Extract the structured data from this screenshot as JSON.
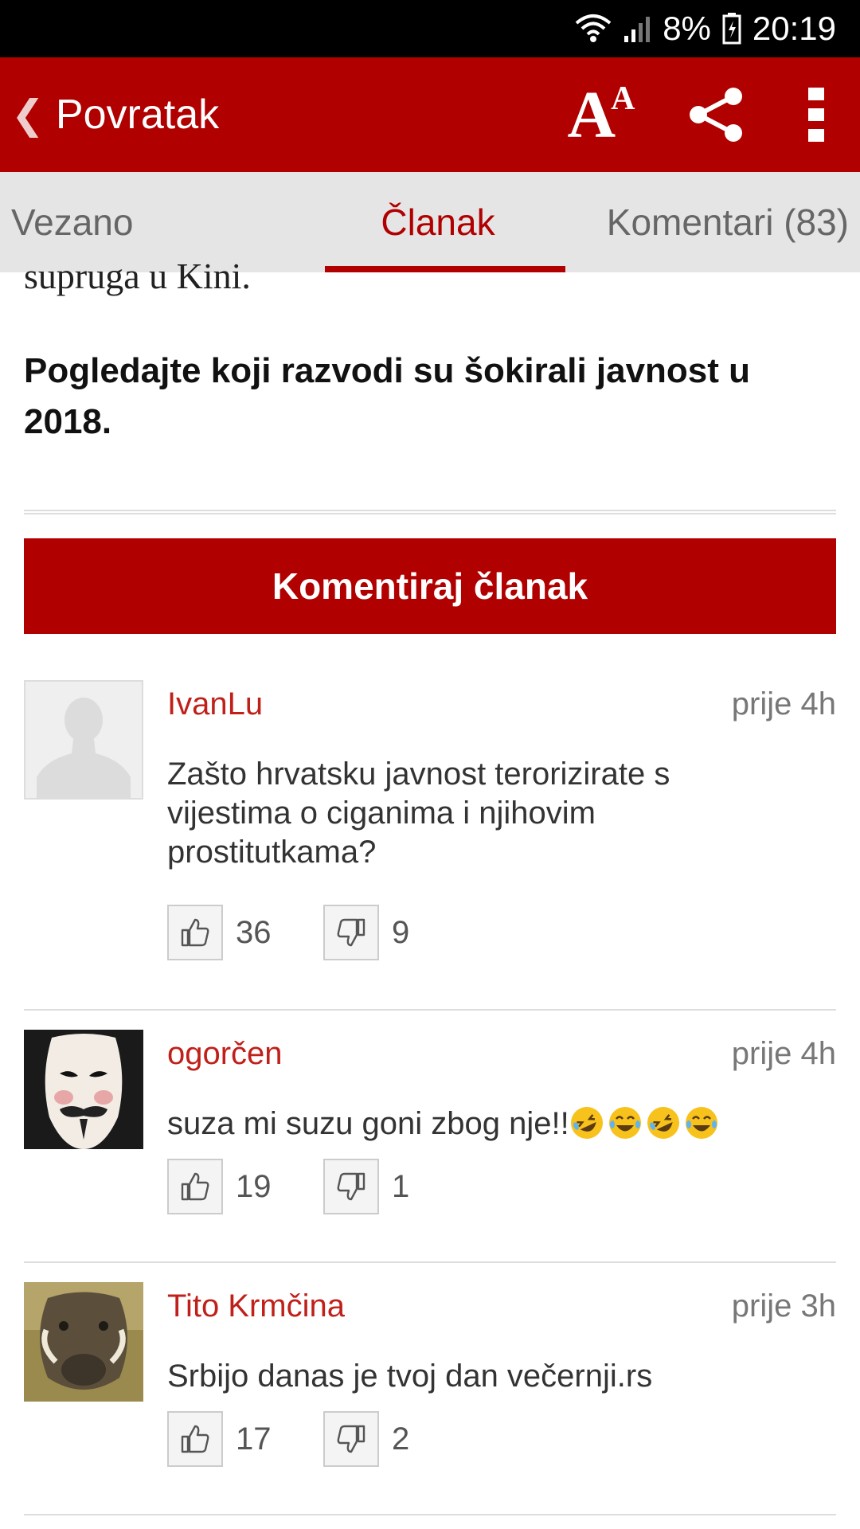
{
  "status_bar": {
    "battery": "8%",
    "time": "20:19"
  },
  "app_bar": {
    "back_label": "Povratak"
  },
  "tabs": [
    {
      "label": "Vezano"
    },
    {
      "label": "Članak",
      "active": true
    },
    {
      "label": "Komentari (83)"
    }
  ],
  "article": {
    "cut_text": "supruga u Kini.",
    "bold_text": "Pogledajte koji razvodi su šokirali javnost u 2018."
  },
  "comment_button": {
    "label": "Komentiraj članak"
  },
  "comments": [
    {
      "user": "IvanLu",
      "time": "prije 4h",
      "text": "Zašto hrvatsku javnost terorizirate s vijestima o ciganima i njihovim prostitutkama?",
      "likes": "36",
      "dislikes": "9",
      "avatar": "placeholder-silhouette"
    },
    {
      "user": "ogorčen",
      "time": "prije 4h",
      "text": "suza mi suzu goni zbog nje!!",
      "emojis": [
        "rofl",
        "laugh",
        "rofl",
        "laugh"
      ],
      "likes": "19",
      "dislikes": "1",
      "avatar": "guy-fawkes-mask"
    },
    {
      "user": "Tito Krmčina",
      "time": "prije 3h",
      "text": "Srbijo danas je tvoj dan večernji.rs",
      "likes": "17",
      "dislikes": "2",
      "avatar": "warthog-photo"
    }
  ],
  "colors": {
    "brand_red": "#b00000",
    "username_red": "#c0201a"
  }
}
